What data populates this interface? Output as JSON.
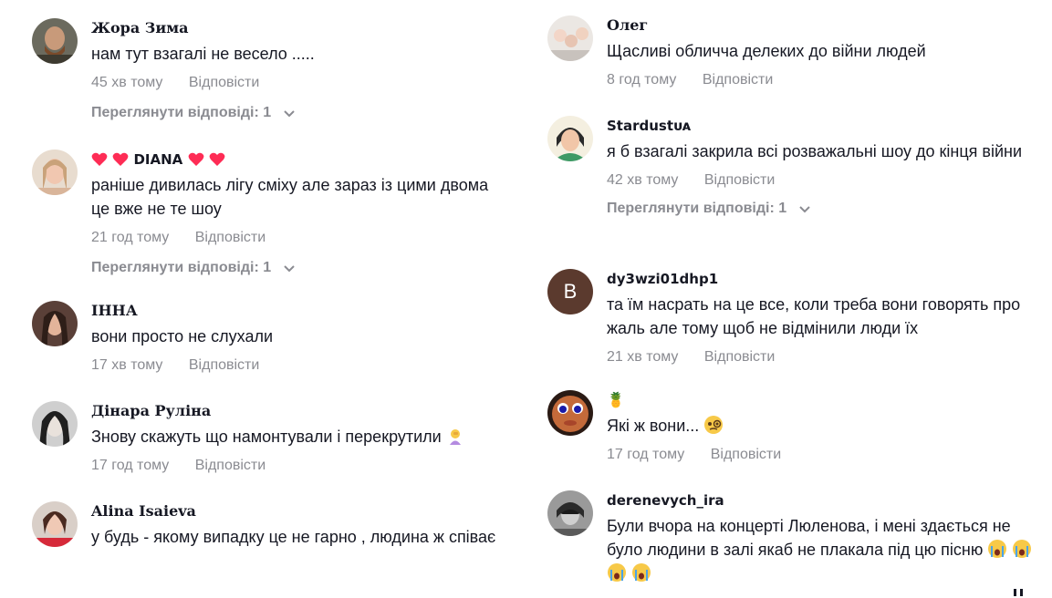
{
  "comments_left": [
    {
      "username": "Жора Зима",
      "text": "нам тут взагалі не весело .....",
      "time": "45 хв тому",
      "reply_label": "Відповісти",
      "view_replies_label": "Переглянути відповіді: 1"
    },
    {
      "username": "DIANA",
      "text": "раніше дивилась лігу сміху але зараз із цими двома це вже не те шоу",
      "time": "21 год тому",
      "reply_label": "Відповісти",
      "view_replies_label": "Переглянути відповіді: 1"
    },
    {
      "username": "ІННА",
      "text": "вони просто не слухали",
      "time": "17 хв тому",
      "reply_label": "Відповісти"
    },
    {
      "username": "Дінара Руліна",
      "text": "Знову скажуть що намонтували і перекрутили",
      "time": "17 год тому",
      "reply_label": "Відповісти"
    },
    {
      "username": "Alina Isaieva",
      "text": "у будь - якому випадку це не гарно , людина ж співає"
    }
  ],
  "comments_right": [
    {
      "username": "Олег",
      "text": "Щасливі обличча делеких до війни людей",
      "time": "8 год тому",
      "reply_label": "Відповісти"
    },
    {
      "username": "Stardustᴜᴀ",
      "text": "я б взагалі закрила всі розважальні шоу до кінця війни",
      "time": "42 хв тому",
      "reply_label": "Відповісти",
      "view_replies_label": "Переглянути відповіді: 1"
    },
    {
      "username": "dy3wzi01dhp1",
      "avatar_letter": "B",
      "text": "та їм насрать на це все, коли треба вони говорять про жаль але тому щоб не відмінили люди їх",
      "time": "21 хв тому",
      "reply_label": "Відповісти"
    },
    {
      "username": "🍍",
      "text": "Які ж вони...",
      "time": "17 год тому",
      "reply_label": "Відповісти"
    },
    {
      "username": "derenevych_ira",
      "text": "Були вчора на концерті Люленова, і мені здається не було людини в залі якаб не плакала під цю пісню"
    }
  ],
  "colors": {
    "text_primary": "#161823",
    "text_secondary": "#8a8b91",
    "heart": "#fe2c55",
    "avatar_letter_bg": "#5b3a2e"
  }
}
